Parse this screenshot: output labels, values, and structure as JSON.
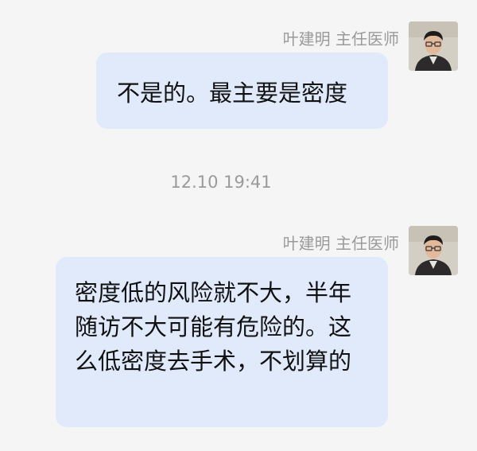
{
  "messages": [
    {
      "sender": "叶建明 主任医师",
      "text": "不是的。最主要是密度"
    },
    {
      "sender": "叶建明 主任医师",
      "text": "密度低的风险就不大，半年随访不大可能有危险的。这么低密度去手术，不划算的"
    }
  ],
  "timestamp": "12.10 19:41",
  "colors": {
    "background": "#f5f5f5",
    "bubble": "#e0eafa",
    "meta_text": "#9a9a9a"
  },
  "icons": {
    "avatar": "doctor-avatar"
  }
}
